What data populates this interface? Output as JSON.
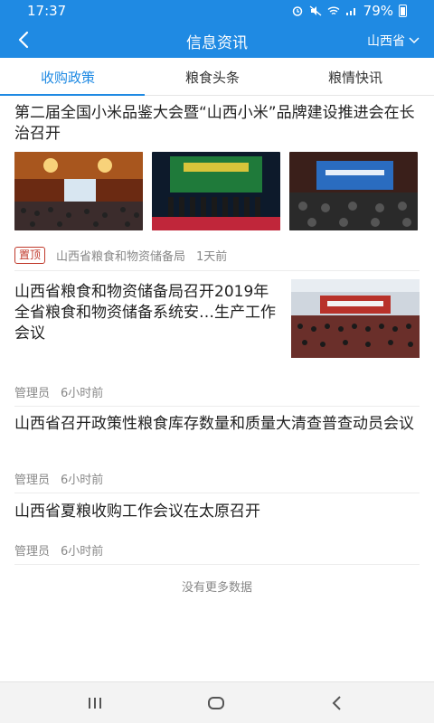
{
  "status": {
    "time": "17:37",
    "battery": "79%"
  },
  "header": {
    "title": "信息资讯",
    "region": "山西省"
  },
  "tabs": [
    {
      "label": "收购政策",
      "active": true
    },
    {
      "label": "粮食头条",
      "active": false
    },
    {
      "label": "粮情快讯",
      "active": false
    }
  ],
  "articles": [
    {
      "title": "第二届全国小米品鉴大会暨“山西小米”品牌建设推进会在长治召开",
      "pin": "置顶",
      "source": "山西省粮食和物资储备局",
      "time": "1天前"
    },
    {
      "title": "山西省粮食和物资储备局召开2019年 全省粮食和物资储备系统安…生产工作会议",
      "source": "管理员",
      "time": "6小时前"
    },
    {
      "title": "山西省召开政策性粮食库存数量和质量大清查普查动员会议",
      "source": "管理员",
      "time": "6小时前"
    },
    {
      "title": "山西省夏粮收购工作会议在太原召开",
      "source": "管理员",
      "time": "6小时前"
    }
  ],
  "footer": {
    "no_more": "没有更多数据"
  },
  "icons": {
    "back": "back-arrow-icon",
    "region": "chevron-down-icon"
  },
  "colors": {
    "primary": "#1f8ae3",
    "pin": "#c0392b"
  }
}
